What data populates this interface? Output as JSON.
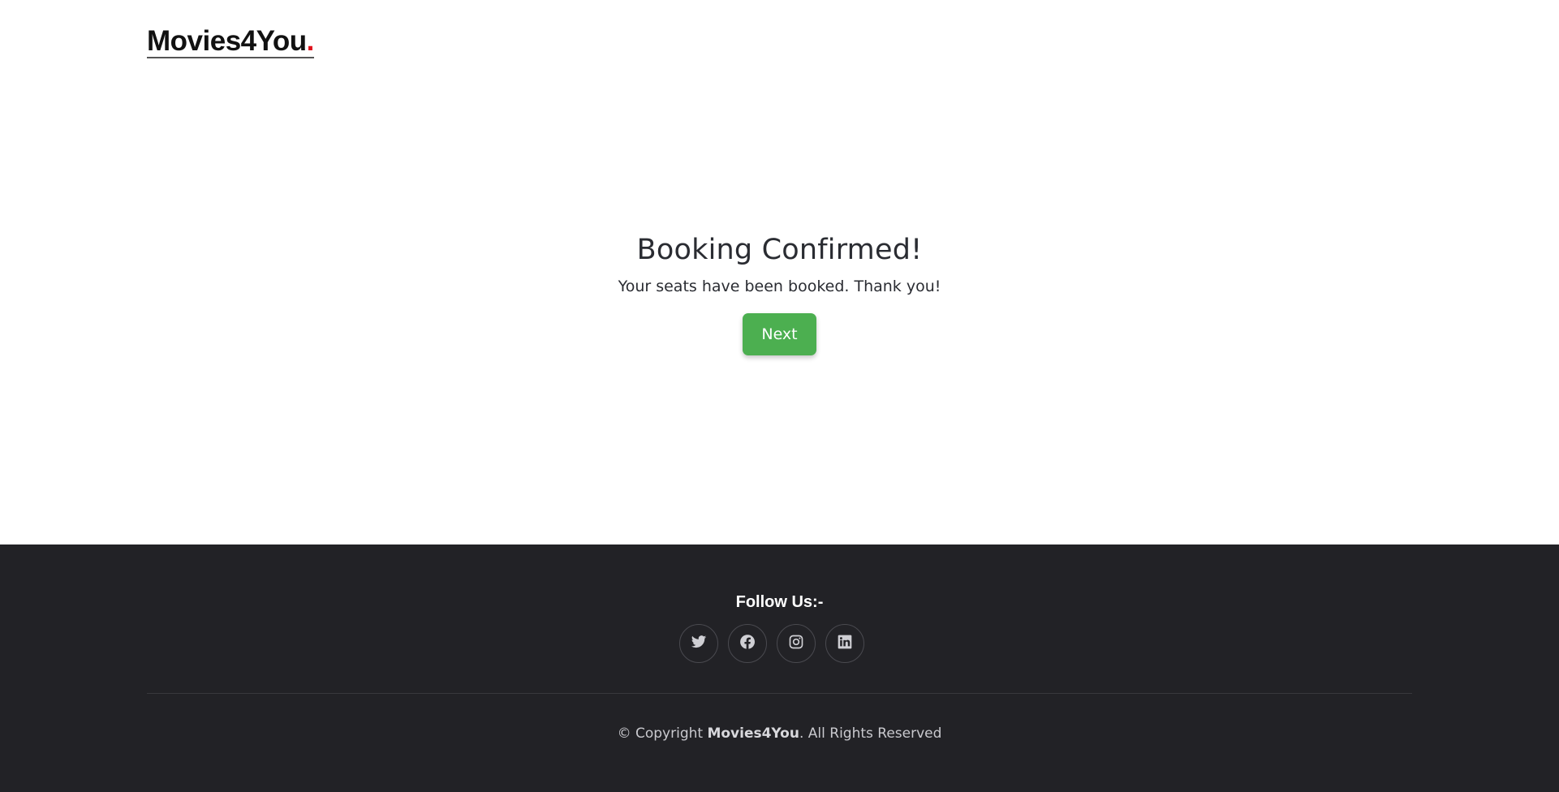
{
  "header": {
    "logo_text": "Movies4You",
    "logo_dot": "."
  },
  "confirmation": {
    "title": "Booking Confirmed!",
    "message": "Your seats have been booked. Thank you!",
    "next_label": "Next"
  },
  "footer": {
    "follow_title": "Follow Us:-",
    "social": [
      {
        "name": "twitter-icon"
      },
      {
        "name": "facebook-icon"
      },
      {
        "name": "instagram-icon"
      },
      {
        "name": "linkedin-icon"
      }
    ],
    "copyright_prefix": "© Copyright ",
    "copyright_brand": "Movies4You",
    "copyright_suffix": ". All Rights Reserved"
  },
  "colors": {
    "accent": "#4caf50",
    "logo_dot": "#e0121c",
    "footer_bg": "#222226"
  }
}
